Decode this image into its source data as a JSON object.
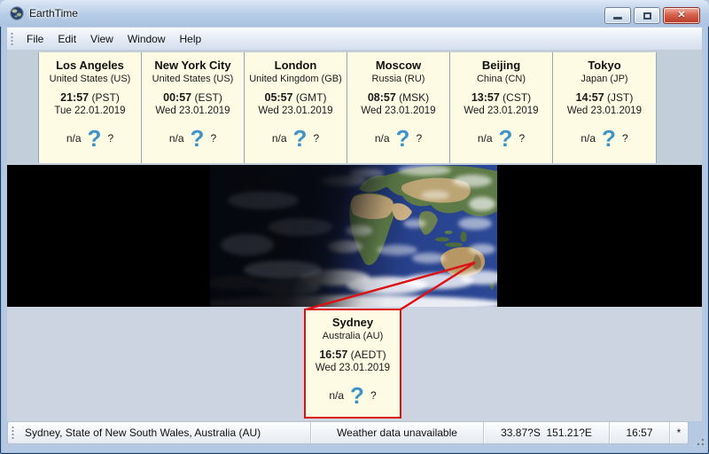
{
  "window": {
    "title": "EarthTime"
  },
  "menu": {
    "items": [
      "File",
      "Edit",
      "View",
      "Window",
      "Help"
    ]
  },
  "clocks": [
    {
      "city": "Los Angeles",
      "country": "United States (US)",
      "time": "21:57",
      "tz": "(PST)",
      "date": "Tue 22.01.2019"
    },
    {
      "city": "New York City",
      "country": "United States (US)",
      "time": "00:57",
      "tz": "(EST)",
      "date": "Wed 23.01.2019"
    },
    {
      "city": "London",
      "country": "United Kingdom (GB)",
      "time": "05:57",
      "tz": "(GMT)",
      "date": "Wed 23.01.2019"
    },
    {
      "city": "Moscow",
      "country": "Russia (RU)",
      "time": "08:57",
      "tz": "(MSK)",
      "date": "Wed 23.01.2019"
    },
    {
      "city": "Beijing",
      "country": "China (CN)",
      "time": "13:57",
      "tz": "(CST)",
      "date": "Wed 23.01.2019"
    },
    {
      "city": "Tokyo",
      "country": "Japan (JP)",
      "time": "14:57",
      "tz": "(JST)",
      "date": "Wed 23.01.2019"
    }
  ],
  "weather_placeholder": {
    "na": "n/a",
    "big": "?",
    "small": "?"
  },
  "popup": {
    "city": "Sydney",
    "country": "Australia (AU)",
    "time": "16:57",
    "tz": "(AEDT)",
    "date": "Wed 23.01.2019"
  },
  "statusbar": {
    "location": "Sydney, State of New South Wales, Australia (AU)",
    "weather": "Weather data unavailable",
    "coords": "33.87?S  151.21?E",
    "time": "16:57",
    "flag": "*"
  },
  "colors": {
    "panel_cream": "#fdfbe3",
    "callout_red": "#dd1111",
    "question_blue": "#3e94c9",
    "titlebar_blue": "#b6cce6"
  }
}
